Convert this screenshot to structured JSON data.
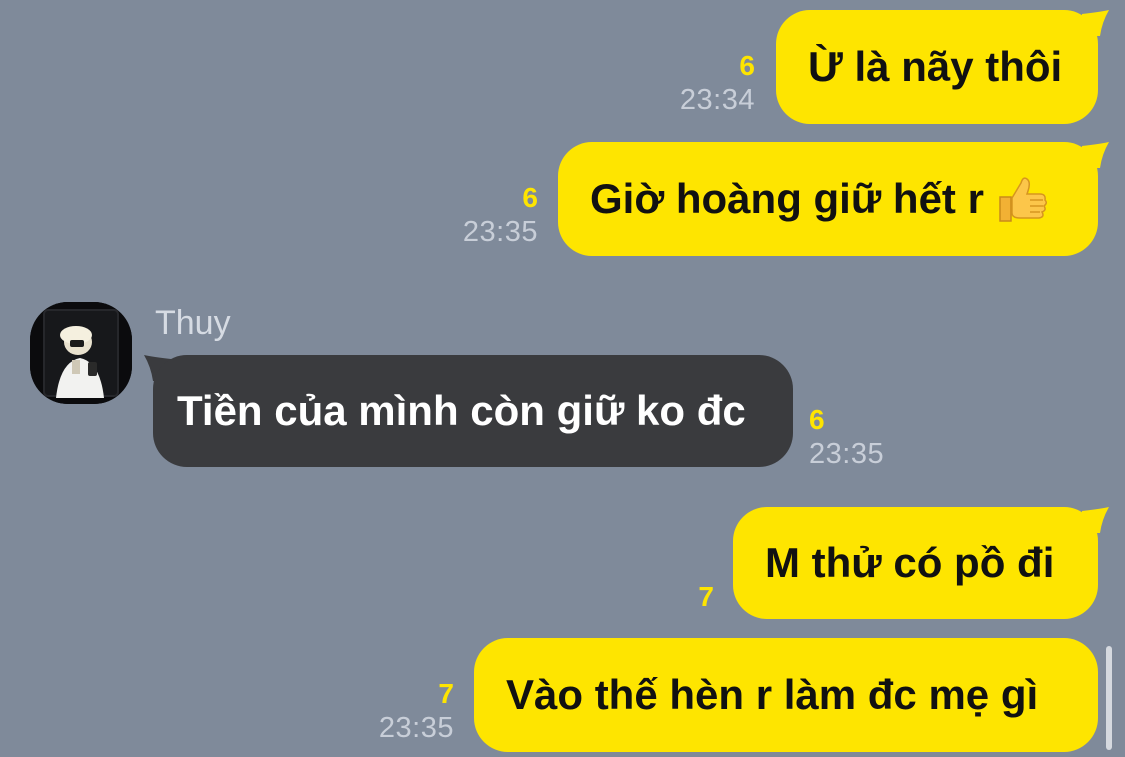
{
  "theme": {
    "background": "#7f8a9a",
    "outgoing_bubble": "#fee500",
    "incoming_bubble": "#3a3b3e",
    "read_count_color": "#fee500",
    "timestamp_color": "#c8ced8"
  },
  "messages": [
    {
      "direction": "outgoing",
      "text": "Ừ là nãy thôi",
      "read_count": "6",
      "time": "23:34"
    },
    {
      "direction": "outgoing",
      "text": "Giờ hoàng giữ hết r",
      "emoji": "thumbs-up-icon",
      "read_count": "6",
      "time": "23:35"
    },
    {
      "direction": "incoming",
      "sender": "Thuy",
      "text": "Tiền của mình còn giữ ko đc",
      "read_count": "6",
      "time": "23:35"
    },
    {
      "direction": "outgoing",
      "text": "M thử có pồ đi",
      "read_count": "7",
      "time": ""
    },
    {
      "direction": "outgoing",
      "text": "Vào thế hèn r làm đc mẹ gì",
      "read_count": "7",
      "time": "23:35"
    }
  ]
}
